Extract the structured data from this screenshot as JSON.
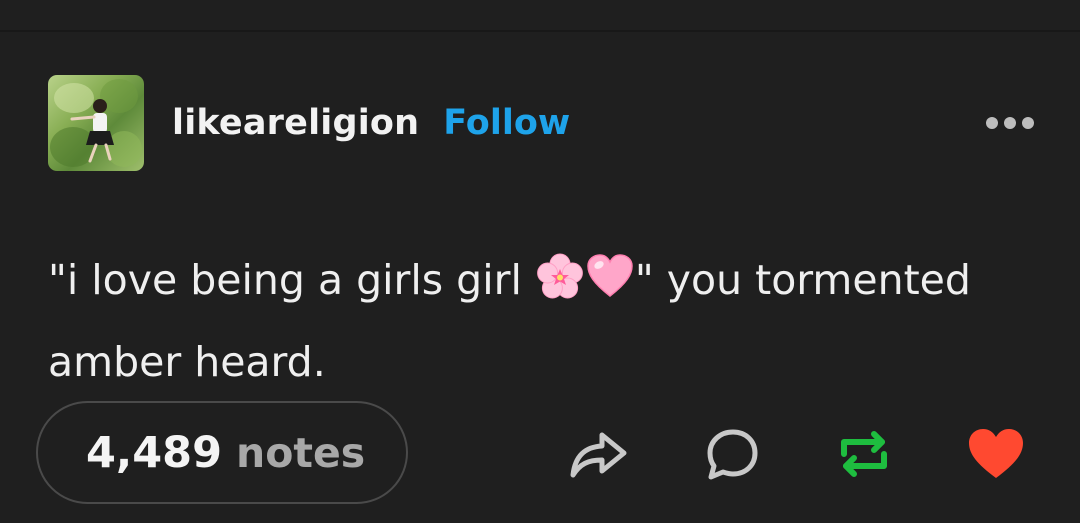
{
  "post": {
    "username": "likeareligion",
    "follow_label": "Follow",
    "text_before_emoji": "\"i love being a girls girl ",
    "text_after_emoji": "\" you tormented amber heard.",
    "emoji_icons": [
      "cherry-blossom-icon",
      "pink-heart-icon"
    ],
    "notes_count": "4,489",
    "notes_label": "notes"
  },
  "actions": [
    "share-icon",
    "reply-icon",
    "reblog-icon",
    "like-icon"
  ],
  "colors": {
    "background": "#1f1f1f",
    "follow": "#1ea3ea",
    "reblog": "#1ebd3f",
    "like": "#ff4930",
    "icon": "#c8c8c8"
  }
}
